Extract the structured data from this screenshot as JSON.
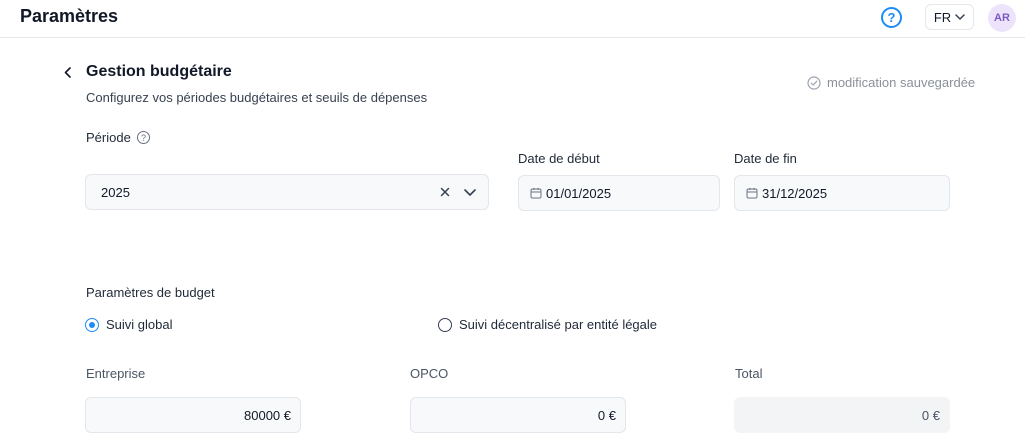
{
  "header": {
    "title": "Paramètres",
    "help_symbol": "?",
    "language": "FR",
    "avatar_initials": "AR"
  },
  "page": {
    "title": "Gestion budgétaire",
    "subtitle": "Configurez vos périodes budgétaires et seuils de dépenses",
    "save_status": "modification sauvegardée"
  },
  "period": {
    "label": "Période",
    "value": "2025",
    "start_label": "Date de début",
    "start_value": "01/01/2025",
    "end_label": "Date de fin",
    "end_value": "31/12/2025"
  },
  "budget": {
    "section_label": "Paramètres de budget",
    "options": [
      {
        "label": "Suivi global",
        "selected": true
      },
      {
        "label": "Suivi décentralisé par entité légale",
        "selected": false
      }
    ],
    "fields": [
      {
        "label": "Entreprise",
        "value": "80000 €"
      },
      {
        "label": "OPCO",
        "value": "0 €"
      },
      {
        "label": "Total",
        "value": "0 €"
      }
    ]
  },
  "icons": {
    "back": "chevron-left-icon",
    "help": "help-circle-icon",
    "language_dropdown": "chevron-down-icon",
    "save_status": "check-circle-icon",
    "info": "info-icon",
    "clear": "close-icon",
    "dropdown": "chevron-down-icon",
    "calendar": "calendar-icon"
  },
  "colors": {
    "accent": "#1d8cf8",
    "avatar_bg": "#ede4fb",
    "avatar_text": "#7c5bc4",
    "muted_text": "#8b9099",
    "field_bg": "#f8f9fb"
  }
}
